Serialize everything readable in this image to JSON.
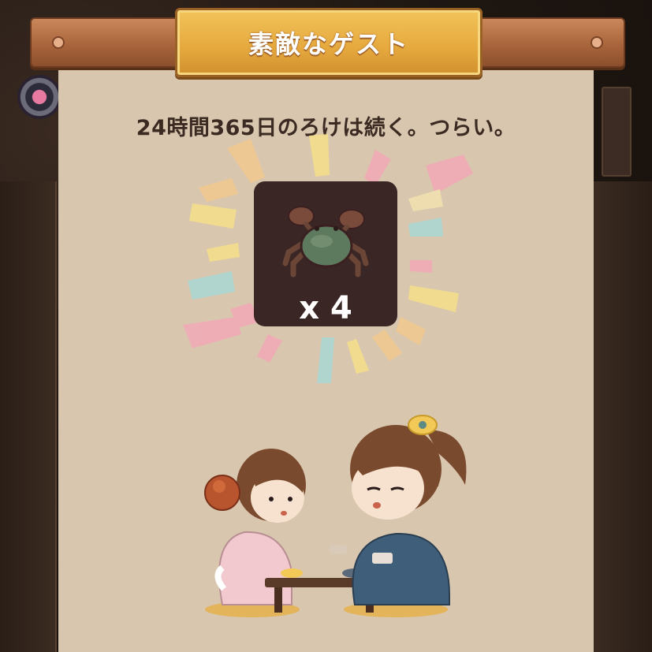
{
  "dialog": {
    "title": "素敵なゲスト",
    "message": "24時間365日のろけは続く。つらい。"
  },
  "reward": {
    "item_icon": "crab-icon",
    "quantity_label": "x 4",
    "quantity": 4
  },
  "colors": {
    "panel": "#d8c6ae",
    "title_plate": "#e5a83d",
    "item_box": "#3a2625",
    "message_text": "#3a2a22"
  },
  "scene": {
    "characters": [
      "girl-in-pink-kimono",
      "boy-in-blue-kimono"
    ],
    "props": [
      "low-table",
      "floor-cushions"
    ]
  }
}
